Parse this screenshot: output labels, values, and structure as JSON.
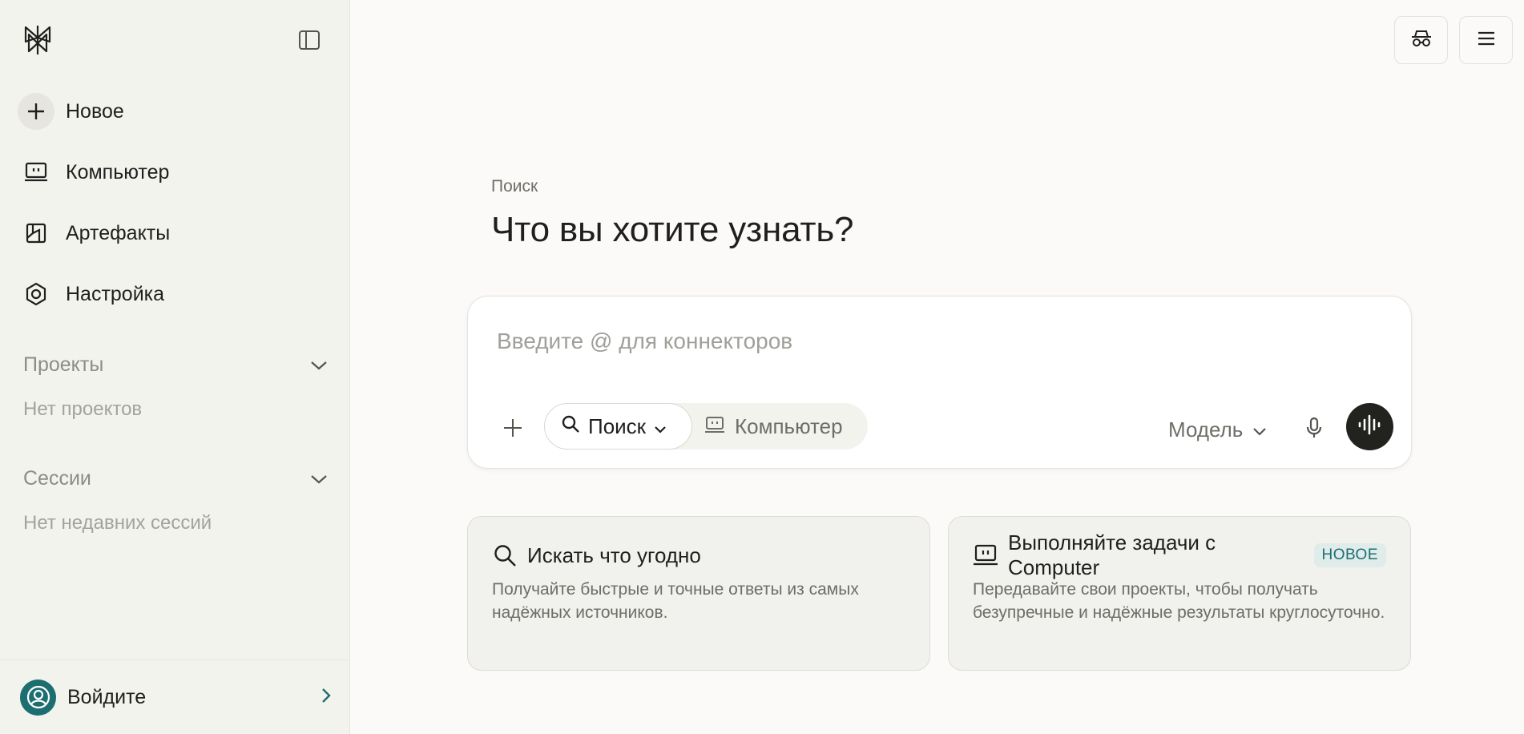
{
  "sidebar": {
    "nav": [
      {
        "label": "Новое",
        "icon": "plus-icon"
      },
      {
        "label": "Компьютер",
        "icon": "computer-icon"
      },
      {
        "label": "Артефакты",
        "icon": "artifacts-icon"
      },
      {
        "label": "Настройка",
        "icon": "settings-icon"
      }
    ],
    "projects": {
      "title": "Проекты",
      "empty": "Нет проектов"
    },
    "sessions": {
      "title": "Сессии",
      "empty": "Нет недавних сессий"
    },
    "login": {
      "label": "Войдите"
    }
  },
  "main": {
    "crumb": "Поиск",
    "headline": "Что вы хотите узнать?",
    "composer": {
      "placeholder": "Введите @ для коннекторов",
      "mode_search": "Поиск",
      "mode_computer": "Компьютер",
      "model": "Модель"
    },
    "cards": [
      {
        "title": "Искать что угодно",
        "desc": "Получайте быстрые и точные ответы из самых надёжных источников."
      },
      {
        "title": "Выполняйте задачи с ",
        "brand": "Computer",
        "badge": "НОВОЕ",
        "desc": "Передавайте свои проекты, чтобы получать безупречные и надёжные результаты круглосуточно."
      }
    ]
  },
  "colors": {
    "accent": "#1d6e70",
    "sidebar_bg": "#f3f3ee",
    "page_bg": "#fbfaf9"
  }
}
